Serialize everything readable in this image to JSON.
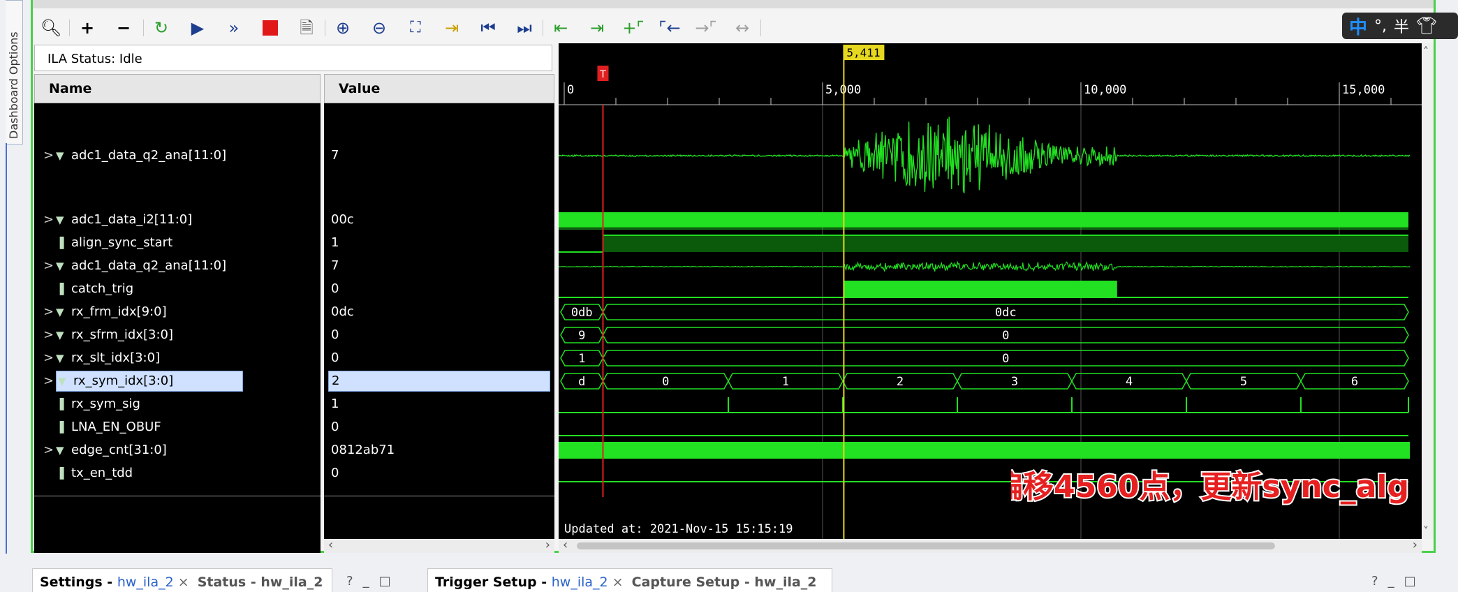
{
  "dashboard_tab": {
    "label": "Dashboard Options"
  },
  "ime": {
    "zh": "中",
    "marks": "°,",
    "half": "半"
  },
  "status": {
    "text": "ILA Status: Idle"
  },
  "columns": {
    "name": "Name",
    "value": "Value"
  },
  "signals": [
    {
      "name": "adc1_data_q2_ana[11:0]",
      "value": "7",
      "type": "bus",
      "expand": true
    },
    {
      "name": "adc1_data_i2[11:0]",
      "value": "00c",
      "type": "bus",
      "expand": true
    },
    {
      "name": "align_sync_start",
      "value": "1",
      "type": "bit",
      "expand": false
    },
    {
      "name": "adc1_data_q2_ana[11:0]",
      "value": "7",
      "type": "bus",
      "expand": true
    },
    {
      "name": "catch_trig",
      "value": "0",
      "type": "bit",
      "expand": false
    },
    {
      "name": "rx_frm_idx[9:0]",
      "value": "0dc",
      "type": "bus",
      "expand": true
    },
    {
      "name": "rx_sfrm_idx[3:0]",
      "value": "0",
      "type": "bus",
      "expand": true
    },
    {
      "name": "rx_slt_idx[3:0]",
      "value": "0",
      "type": "bus",
      "expand": true
    },
    {
      "name": "rx_sym_idx[3:0]",
      "value": "2",
      "type": "bus",
      "expand": true,
      "selected": true
    },
    {
      "name": "rx_sym_sig",
      "value": "1",
      "type": "bit",
      "expand": false
    },
    {
      "name": "LNA_EN_OBUF",
      "value": "0",
      "type": "bit",
      "expand": false
    },
    {
      "name": "edge_cnt[31:0]",
      "value": "0812ab71",
      "type": "bus",
      "expand": true
    },
    {
      "name": "tx_en_tdd",
      "value": "0",
      "type": "bit",
      "expand": false
    }
  ],
  "waveform": {
    "cursor_label": "5,411",
    "trigger_label": "T",
    "time_ticks": [
      "0",
      "5,000",
      "10,000",
      "15,000"
    ],
    "bus_values": {
      "rx_frm_idx": [
        "0db",
        "0dc"
      ],
      "rx_sfrm_idx": [
        "9",
        "0"
      ],
      "rx_slt_idx": [
        "1",
        "0"
      ],
      "rx_sym_idx": [
        "d",
        "0",
        "1",
        "2",
        "3",
        "4",
        "5",
        "6"
      ]
    },
    "updated": "Updated at: 2021-Nov-15 15:15:19",
    "annotation": "偏移4560点，更新sync_alg",
    "colors": {
      "wave": "#22e022",
      "cursor": "#e6d820",
      "trigger": "#e02020",
      "annotation": "#e62020"
    }
  },
  "bottom_tabs": [
    {
      "title": "Settings - ",
      "link": "hw_ila_2"
    },
    {
      "title": "Status - hw_ila_2"
    },
    {
      "title": "Trigger Setup - ",
      "link": "hw_ila_2"
    },
    {
      "title": "Capture Setup - hw_ila_2"
    }
  ],
  "window_controls": [
    "?",
    "_",
    "□"
  ]
}
